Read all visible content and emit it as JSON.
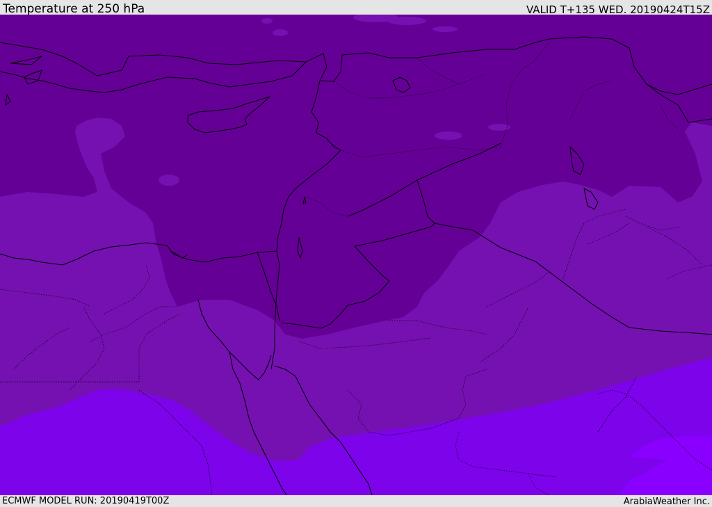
{
  "header": {
    "title": "Temperature at 250 hPa",
    "valid": "VALID T+135 WED. 20190424T15Z"
  },
  "footer": {
    "model_run": "ECMWF MODEL RUN: 20190419T00Z",
    "credit": "ArabiaWeather Inc."
  },
  "colors": {
    "coldest_band": "#650096",
    "cold_band": "#7511b1",
    "warm_band": "#7c03ea",
    "warmest_band": "#8a00ff",
    "coastline": "#000000",
    "border": "#1a0030",
    "header_bg": "#e5e5e5"
  }
}
